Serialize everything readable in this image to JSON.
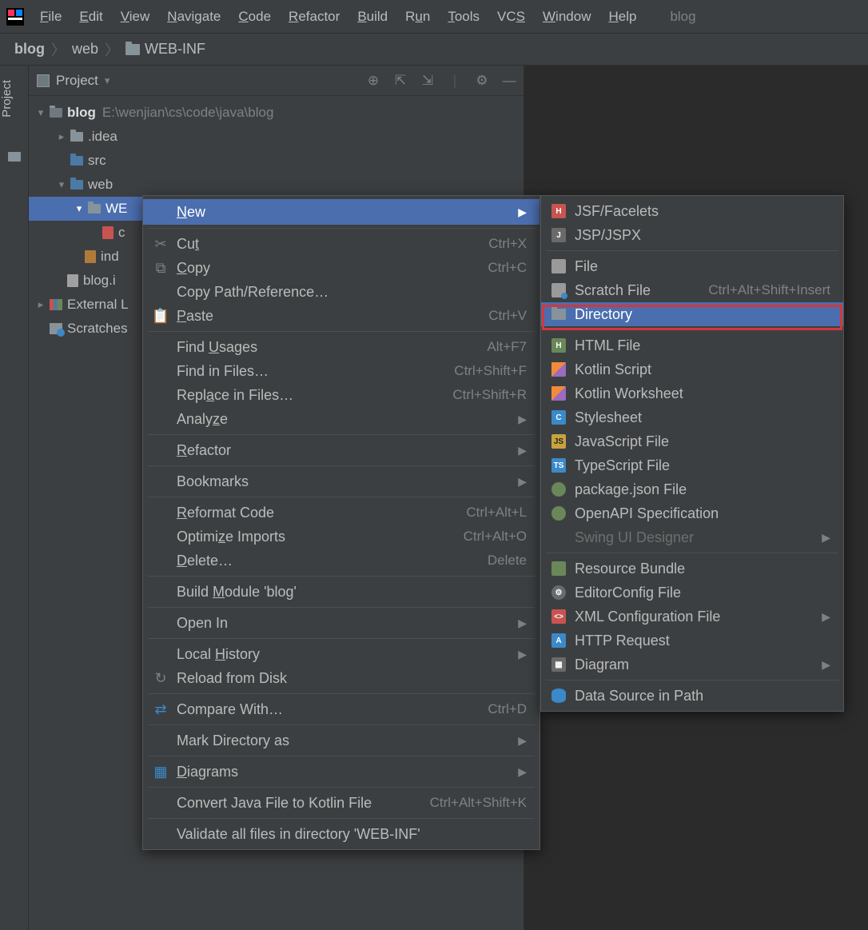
{
  "app": {
    "project_name": "blog"
  },
  "menubar": {
    "items": [
      "File",
      "Edit",
      "View",
      "Navigate",
      "Code",
      "Refactor",
      "Build",
      "Run",
      "Tools",
      "VCS",
      "Window",
      "Help"
    ]
  },
  "breadcrumb": {
    "root": "blog",
    "seg1": "web",
    "seg2": "WEB-INF"
  },
  "left_gutter": {
    "project_tab": "Project"
  },
  "panel": {
    "title": "Project",
    "tree": {
      "root_name": "blog",
      "root_path": "E:\\wenjian\\cs\\code\\java\\blog",
      "idea": ".idea",
      "src": "src",
      "web": "web",
      "webinf": "WE",
      "file1_trunc": "c",
      "file2": "ind",
      "iml": "blog.i",
      "ext_libs": "External L",
      "scratches": "Scratches"
    }
  },
  "ctx1": {
    "new": "New",
    "cut": {
      "label": "Cut",
      "sc": "Ctrl+X"
    },
    "copy": {
      "label": "Copy",
      "sc": "Ctrl+C"
    },
    "copy_path": "Copy Path/Reference…",
    "paste": {
      "label": "Paste",
      "sc": "Ctrl+V"
    },
    "find_usages": {
      "label": "Find Usages",
      "sc": "Alt+F7"
    },
    "find_in_files": {
      "label": "Find in Files…",
      "sc": "Ctrl+Shift+F"
    },
    "replace_in_files": {
      "label": "Replace in Files…",
      "sc": "Ctrl+Shift+R"
    },
    "analyze": "Analyze",
    "refactor": "Refactor",
    "bookmarks": "Bookmarks",
    "reformat": {
      "label": "Reformat Code",
      "sc": "Ctrl+Alt+L"
    },
    "optimize": {
      "label": "Optimize Imports",
      "sc": "Ctrl+Alt+O"
    },
    "delete": {
      "label": "Delete…",
      "sc": "Delete"
    },
    "build_module": "Build Module 'blog'",
    "open_in": "Open In",
    "local_history": "Local History",
    "reload": "Reload from Disk",
    "compare": {
      "label": "Compare With…",
      "sc": "Ctrl+D"
    },
    "mark_dir": "Mark Directory as",
    "diagrams": "Diagrams",
    "convert_kotlin": {
      "label": "Convert Java File to Kotlin File",
      "sc": "Ctrl+Alt+Shift+K"
    },
    "validate": "Validate all files in directory 'WEB-INF'"
  },
  "ctx2": {
    "jsf": "JSF/Facelets",
    "jspx": "JSP/JSPX",
    "file": "File",
    "scratch": {
      "label": "Scratch File",
      "sc": "Ctrl+Alt+Shift+Insert"
    },
    "directory": "Directory",
    "html": "HTML File",
    "kt_script": "Kotlin Script",
    "kt_ws": "Kotlin Worksheet",
    "css": "Stylesheet",
    "js": "JavaScript File",
    "ts": "TypeScript File",
    "pkg": "package.json File",
    "openapi": "OpenAPI Specification",
    "swing": "Swing UI Designer",
    "bundle": "Resource Bundle",
    "editorconfig": "EditorConfig File",
    "xmlcfg": "XML Configuration File",
    "http": "HTTP Request",
    "diagram": "Diagram",
    "ds": "Data Source in Path"
  }
}
